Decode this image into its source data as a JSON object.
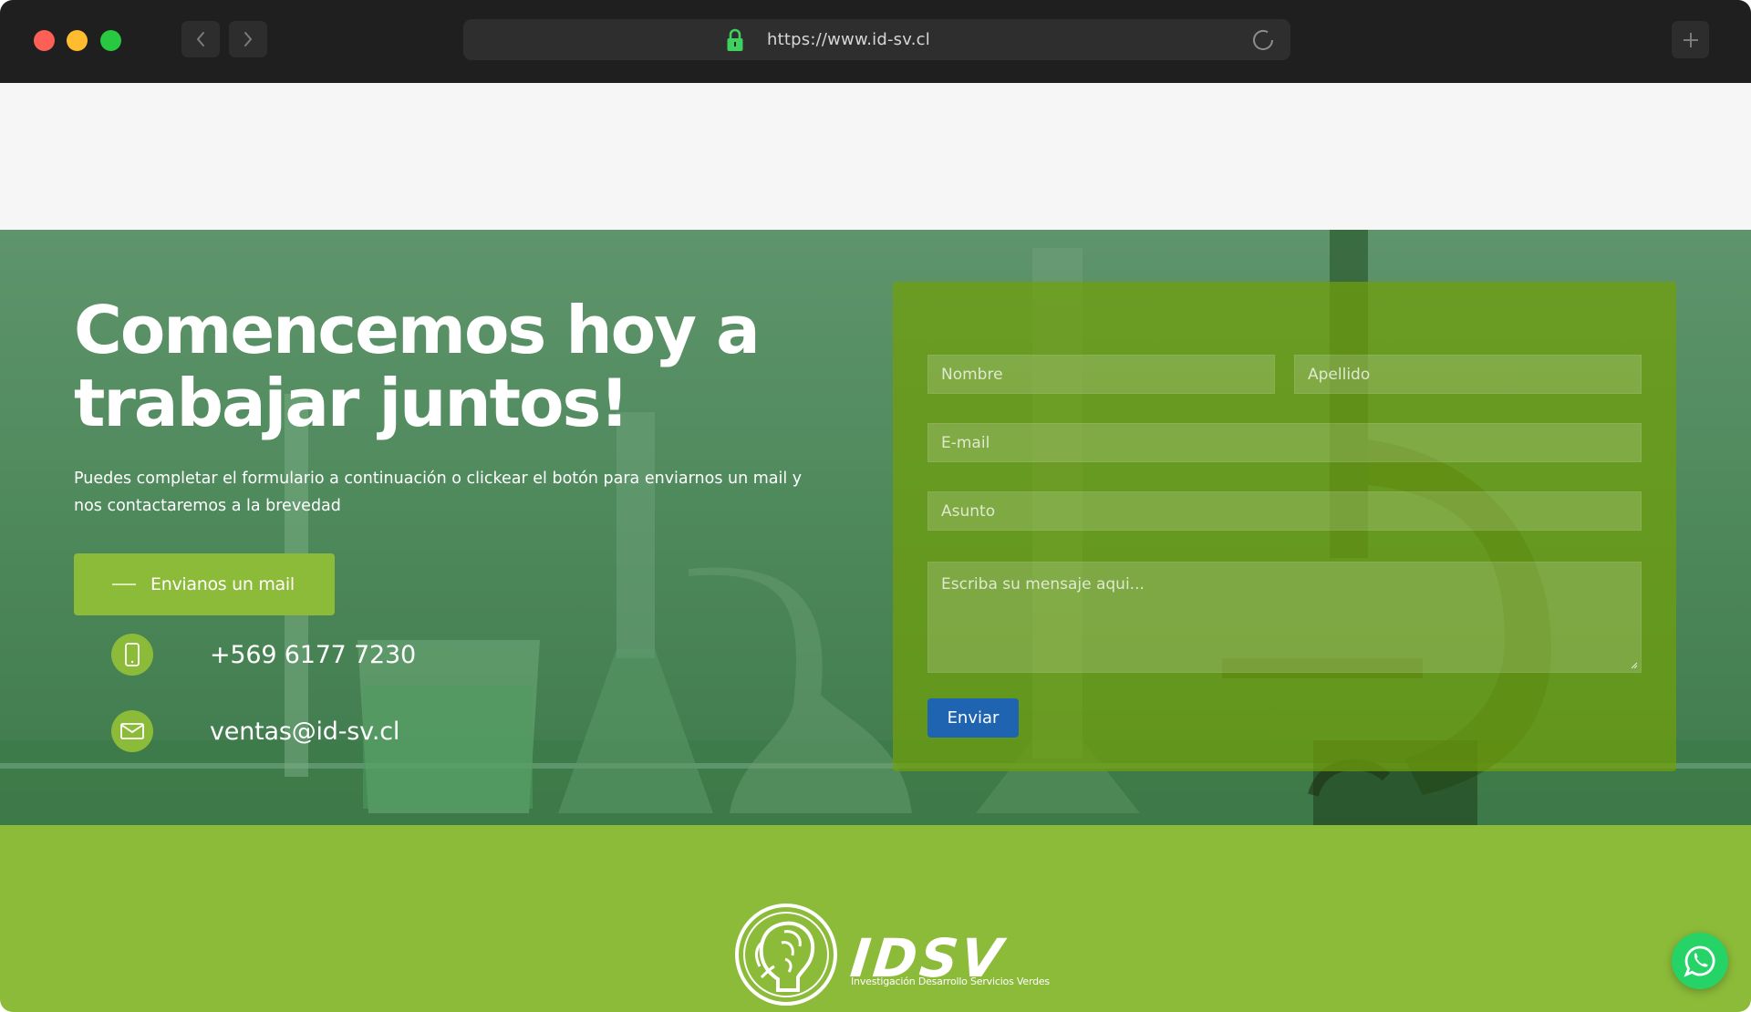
{
  "browser": {
    "url": "https://www.id-sv.cl"
  },
  "hero": {
    "headline_line1": "Comencemos hoy a",
    "headline_line2": "trabajar juntos!",
    "subtext": "Puedes completar el formulario a continuación o clickear el botón para enviarnos un mail y nos contactaremos a la brevedad",
    "mail_button_label": "Envianos un mail",
    "phone": "+569 6177 7230",
    "email": "ventas@id-sv.cl"
  },
  "form": {
    "nombre_placeholder": "Nombre",
    "apellido_placeholder": "Apellido",
    "email_placeholder": "E-mail",
    "asunto_placeholder": "Asunto",
    "mensaje_placeholder": "Escriba su mensaje aqui...",
    "send_label": "Enviar"
  },
  "footer": {
    "logo_text": "IDSV",
    "logo_tagline": "Investigación Desarrollo Servicios Verdes"
  },
  "icons": {
    "lock": "lock-icon",
    "back": "chevron-left-icon",
    "forward": "chevron-right-icon",
    "reload": "reload-icon",
    "new_tab": "plus-icon",
    "phone": "phone-icon",
    "mail": "mail-icon",
    "whatsapp": "whatsapp-icon"
  },
  "colors": {
    "accent_green": "#8cbb39",
    "send_button_blue": "#1f64b1",
    "whatsapp_green": "#25d366"
  }
}
